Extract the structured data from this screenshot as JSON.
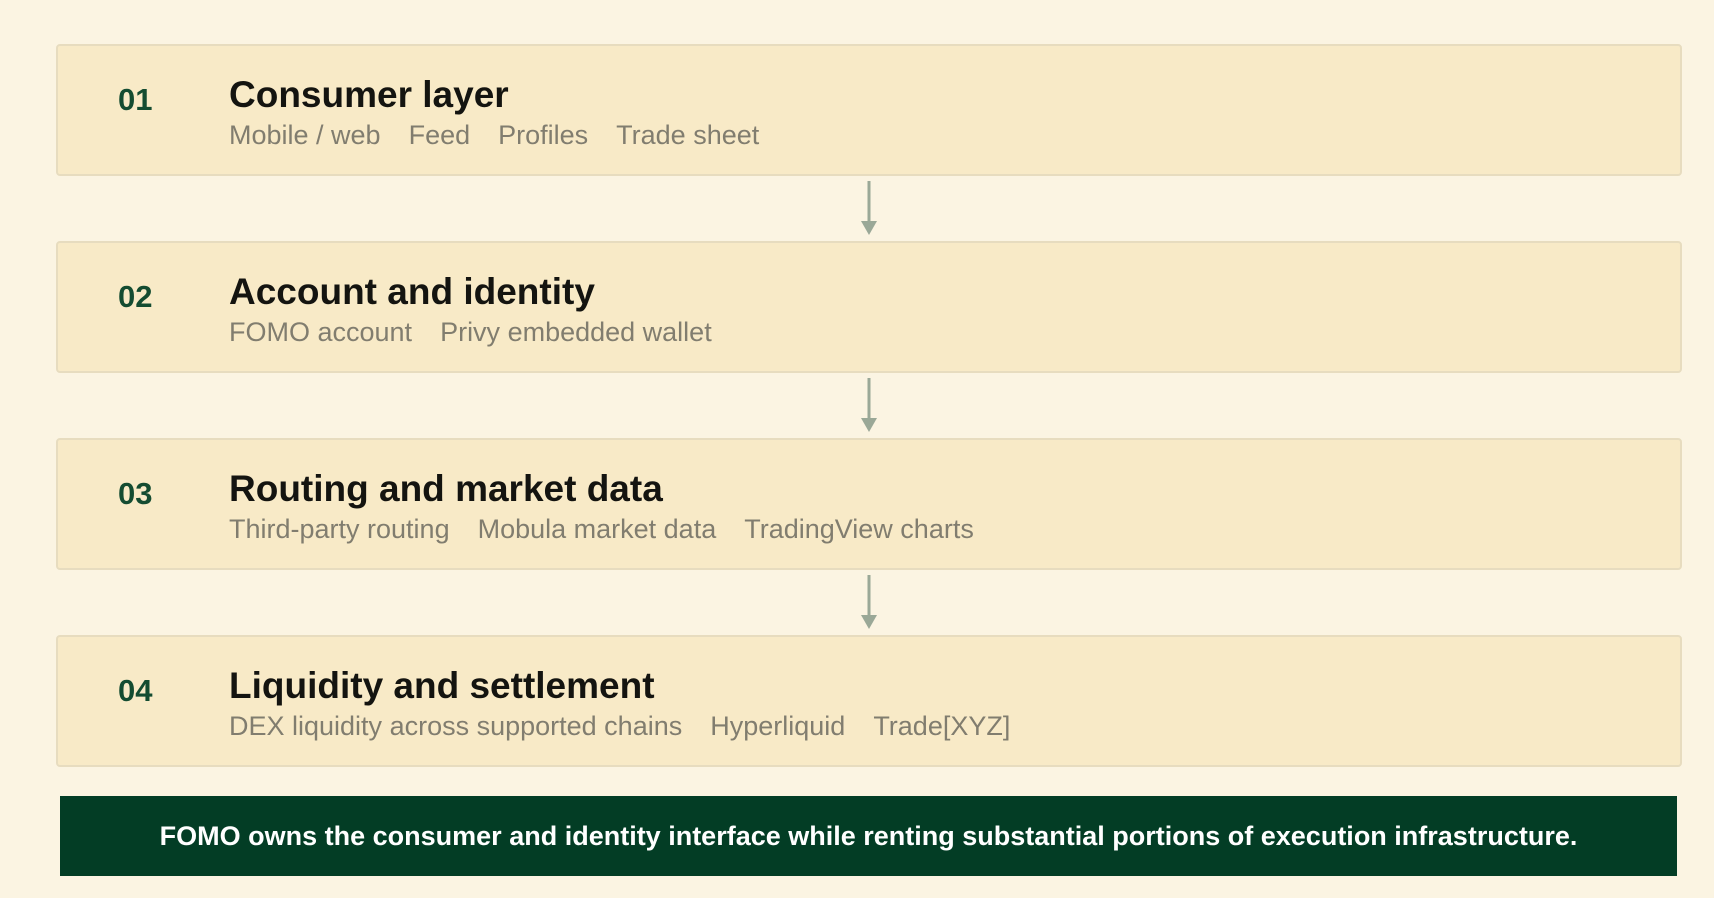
{
  "layers": [
    {
      "number": "01",
      "title": "Consumer layer",
      "items": [
        "Mobile / web",
        "Feed",
        "Profiles",
        "Trade sheet"
      ]
    },
    {
      "number": "02",
      "title": "Account and identity",
      "items": [
        "FOMO account",
        "Privy embedded wallet"
      ]
    },
    {
      "number": "03",
      "title": "Routing and market data",
      "items": [
        "Third-party routing",
        "Mobula market data",
        "TradingView charts"
      ]
    },
    {
      "number": "04",
      "title": "Liquidity and settlement",
      "items": [
        "DEX liquidity across supported chains",
        "Hyperliquid",
        "Trade[XYZ]"
      ]
    }
  ],
  "footer": {
    "text": "FOMO owns the consumer and identity interface while renting substantial portions of execution infrastructure."
  },
  "colors": {
    "background": "#fbf4e2",
    "card": "#f8eac7",
    "accent": "#144c31",
    "footer_bg": "#033d25",
    "arrow": "#9aa897"
  },
  "icons": {
    "connector": "arrow-down-icon"
  }
}
